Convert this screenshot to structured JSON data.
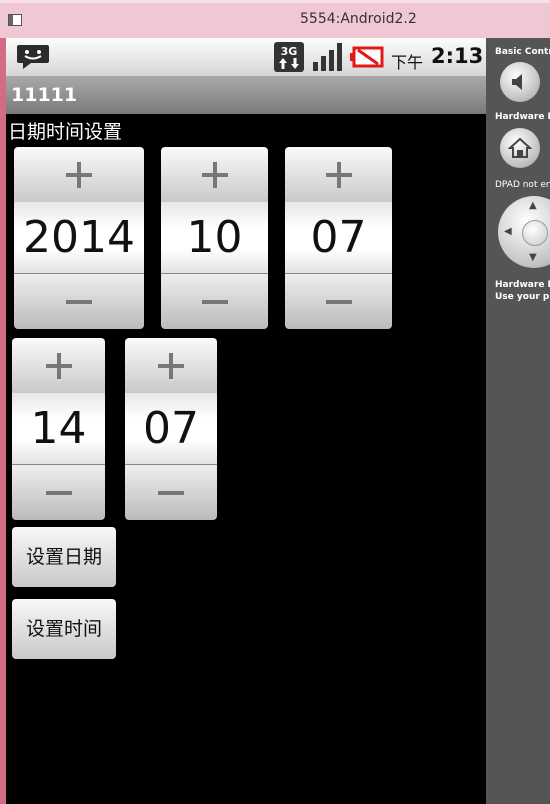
{
  "window": {
    "title": "5554:Android2.2"
  },
  "statusbar": {
    "network_label": "3G",
    "clock_ampm": "下午",
    "clock_time": "2:13"
  },
  "app": {
    "title": "11111"
  },
  "main": {
    "section_label": "日期时间设置",
    "date_picker": {
      "year": "2014",
      "month": "10",
      "day": "07"
    },
    "time_picker": {
      "hour": "14",
      "minute": "07"
    },
    "set_date_button": "设置日期",
    "set_time_button": "设置时间"
  },
  "panel": {
    "basic_controls": "Basic Controls",
    "hardware_buttons": "Hardware Buttons",
    "dpad_label": "DPAD not enabled",
    "hardware_keyboard": "Hardware Keyboard",
    "keyboard_hint": "Use your physical keyboard"
  },
  "icons": {
    "notification": "chat-bubble-icon",
    "network": "3g-data-icon",
    "signal": "signal-strength-icon",
    "battery": "battery-empty-icon",
    "volume": "speaker-icon",
    "home": "home-icon"
  },
  "colors": {
    "window_accent": "#d16b86",
    "battery_alert": "#e01818"
  }
}
